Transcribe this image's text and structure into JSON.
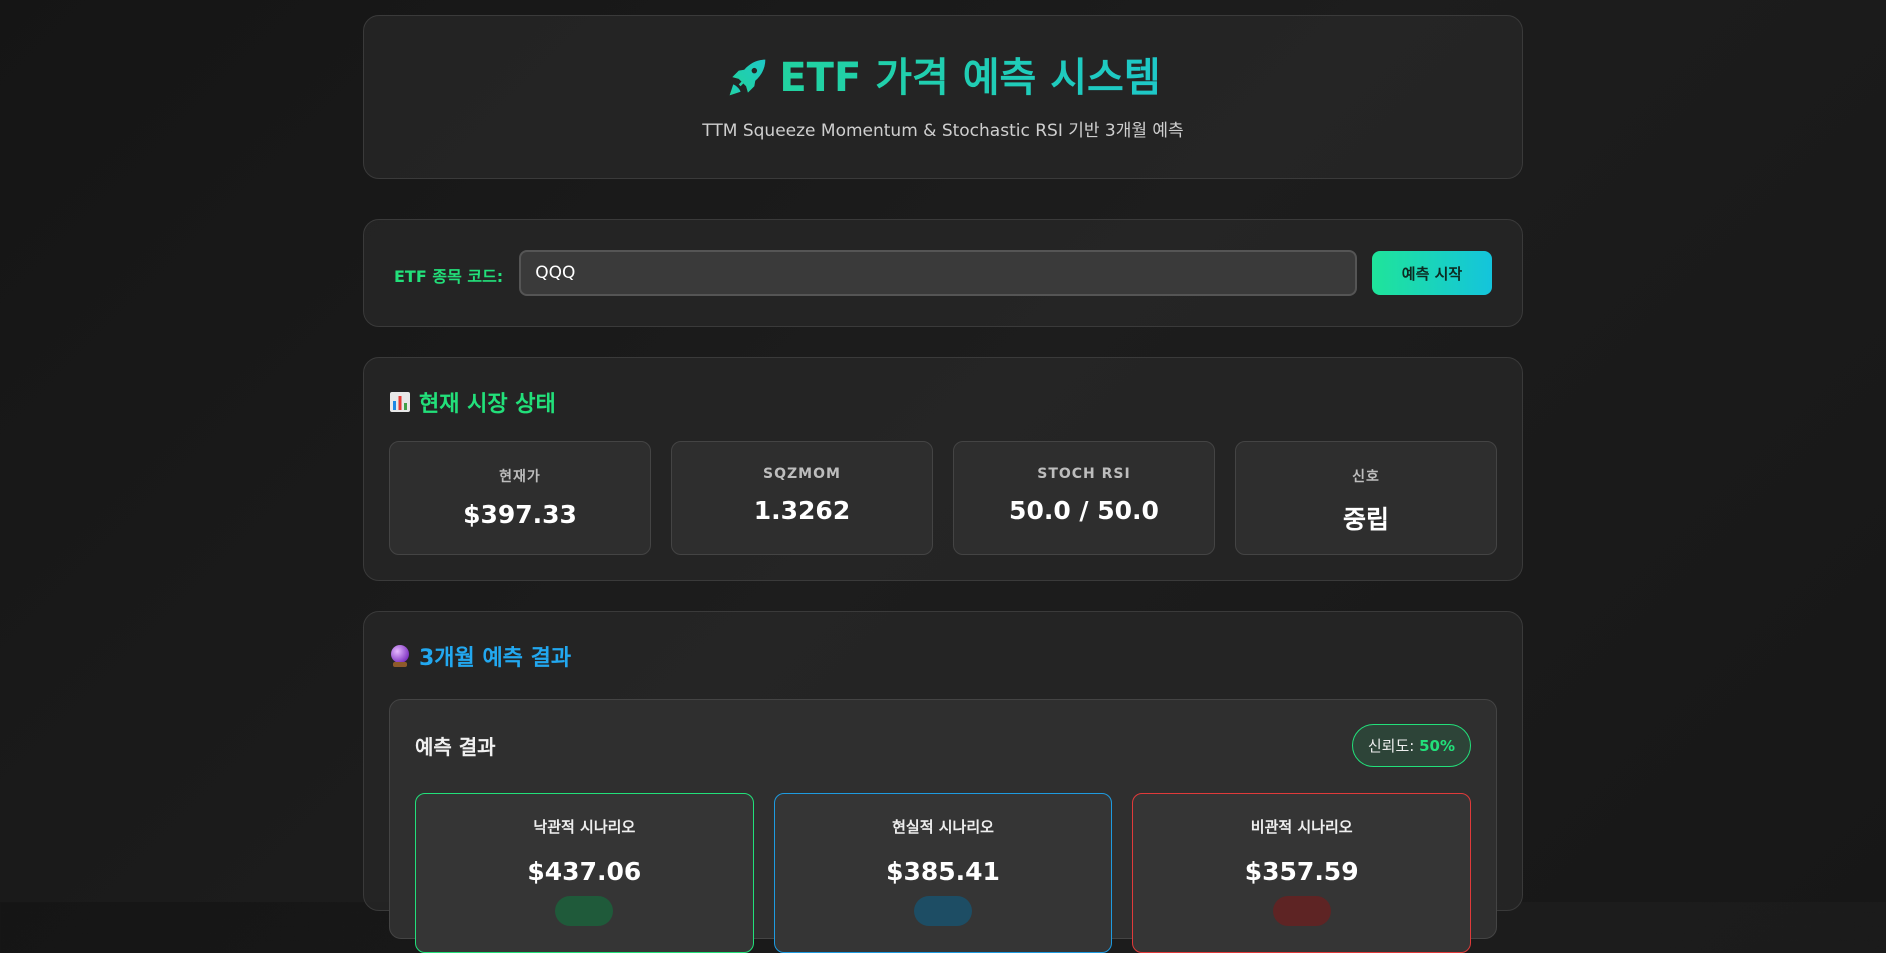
{
  "header": {
    "title": "ETF 가격 예측 시스템",
    "subtitle": "TTM Squeeze Momentum & Stochastic RSI 기반 3개월 예측"
  },
  "input": {
    "label": "ETF 종목 코드:",
    "value": "QQQ",
    "button": "예측 시작"
  },
  "market": {
    "title": "현재 시장 상태",
    "stats": [
      {
        "label": "현재가",
        "value": "$397.33"
      },
      {
        "label": "SQZMOM",
        "value": "1.3262"
      },
      {
        "label": "STOCH RSI",
        "value": "50.0 / 50.0"
      },
      {
        "label": "신호",
        "value": "중립"
      }
    ]
  },
  "prediction": {
    "title": "3개월 예측 결과",
    "inner_title": "예측 결과",
    "confidence_label": "신뢰도: ",
    "confidence_value": "50%",
    "scenarios": [
      {
        "label": "낙관적 시나리오",
        "price": "$437.06"
      },
      {
        "label": "현실적 시나리오",
        "price": "$385.41"
      },
      {
        "label": "비관적 시나리오",
        "price": "$357.59"
      }
    ]
  },
  "colors": {
    "accent_green": "#22e07a",
    "accent_blue": "#22a8f0",
    "accent_red": "#e03a3a"
  }
}
